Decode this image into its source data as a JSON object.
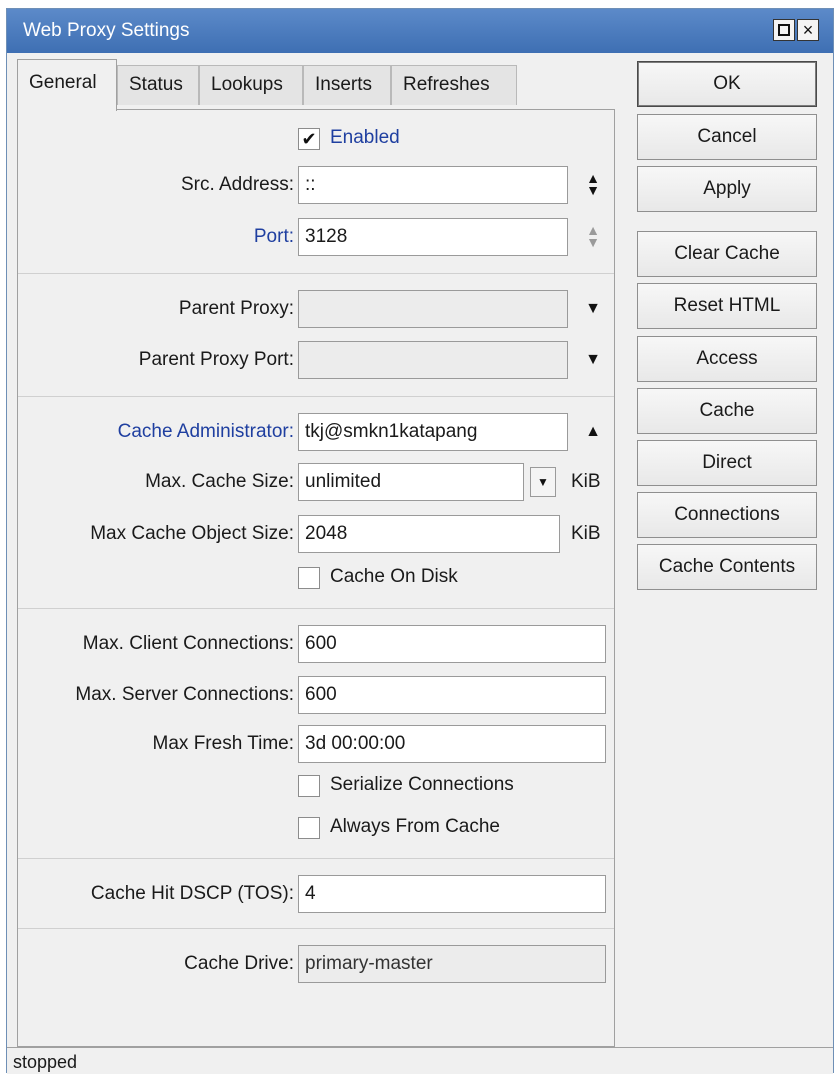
{
  "window": {
    "title": "Web Proxy Settings",
    "restore_glyph": "",
    "close_glyph": "×"
  },
  "tabs": [
    {
      "label": "General",
      "active": true
    },
    {
      "label": "Status"
    },
    {
      "label": "Lookups"
    },
    {
      "label": "Inserts"
    },
    {
      "label": "Refreshes"
    }
  ],
  "general": {
    "enabled": {
      "label": "Enabled",
      "checked": true,
      "mark": "✔"
    },
    "src_address": {
      "label": "Src. Address:",
      "value": "::"
    },
    "port": {
      "label": "Port:",
      "value": "3128"
    },
    "parent_proxy": {
      "label": "Parent Proxy:",
      "value": ""
    },
    "parent_proxy_port": {
      "label": "Parent Proxy Port:",
      "value": ""
    },
    "cache_administrator": {
      "label": "Cache Administrator:",
      "value": "tkj@smkn1katapang"
    },
    "max_cache_size": {
      "label": "Max. Cache Size:",
      "value": "unlimited",
      "unit": "KiB"
    },
    "max_cache_object_size": {
      "label": "Max Cache Object Size:",
      "value": "2048",
      "unit": "KiB"
    },
    "cache_on_disk": {
      "label": "Cache On Disk",
      "checked": false
    },
    "max_client_connections": {
      "label": "Max. Client Connections:",
      "value": "600"
    },
    "max_server_connections": {
      "label": "Max. Server Connections:",
      "value": "600"
    },
    "max_fresh_time": {
      "label": "Max Fresh Time:",
      "value": "3d 00:00:00"
    },
    "serialize_connections": {
      "label": "Serialize Connections",
      "checked": false
    },
    "always_from_cache": {
      "label": "Always From Cache",
      "checked": false
    },
    "cache_hit_dscp": {
      "label": "Cache Hit DSCP (TOS):",
      "value": "4"
    },
    "cache_drive": {
      "label": "Cache Drive:",
      "value": "primary-master"
    }
  },
  "buttons": {
    "ok": "OK",
    "cancel": "Cancel",
    "apply": "Apply",
    "clear_cache": "Clear Cache",
    "reset_html": "Reset HTML",
    "access": "Access",
    "cache": "Cache",
    "direct": "Direct",
    "connections": "Connections",
    "cache_contents": "Cache Contents"
  },
  "icons": {
    "updown": "updown-arrows-icon",
    "dropdown": "triangle-down-icon",
    "collapse": "triangle-up-icon",
    "dropdown_box": "dropdown-box-icon"
  },
  "status": {
    "text": "stopped"
  },
  "colors": {
    "titlebar": "#4a7bbf",
    "highlight_label": "#1f3fa0",
    "panel_bg": "#f0f0f0"
  }
}
